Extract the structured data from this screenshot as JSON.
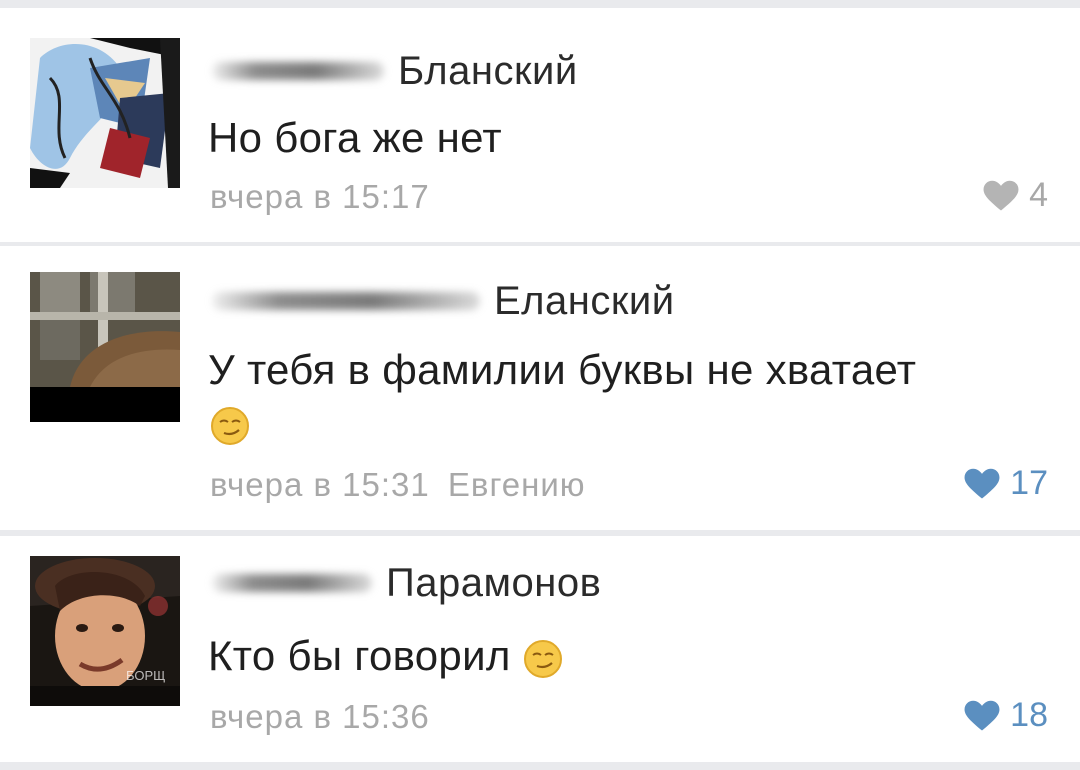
{
  "comments": [
    {
      "surname": "Бланский",
      "text": "Но бога же нет",
      "time": "вчера в 15:17",
      "reply_to": "",
      "likes": "4",
      "liked": false
    },
    {
      "surname": "Еланский",
      "text": "У тебя в фамилии буквы не хватает",
      "time": "вчера в 15:31",
      "reply_to": "Евгению",
      "likes": "17",
      "liked": true
    },
    {
      "surname": "Парамонов",
      "text": "Кто бы говорил",
      "time": "вчера в 15:36",
      "reply_to": "",
      "likes": "18",
      "liked": true
    }
  ],
  "watermark": "БОРЩ",
  "colors": {
    "liked": "#5b8fc0",
    "unliked": "#b4b4b4",
    "meta": "#a8a8a8"
  },
  "icons": {
    "like": "heart-icon",
    "emoji": "smirk-emoji-icon"
  }
}
